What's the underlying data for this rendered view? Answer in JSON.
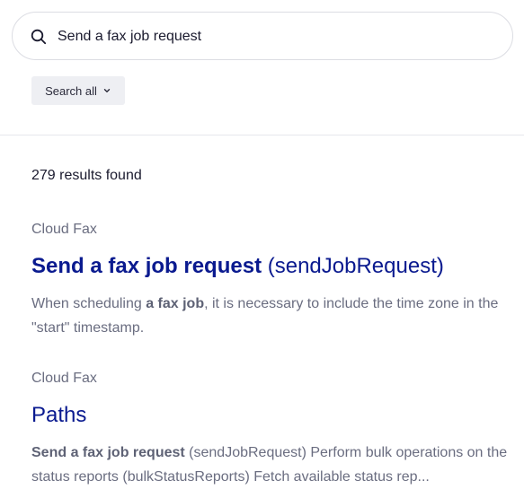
{
  "search": {
    "value": "Send a fax job request",
    "placeholder": "Search"
  },
  "scope": {
    "label": "Search all"
  },
  "results_count": "279 results found",
  "results": [
    {
      "category": "Cloud Fax",
      "title_bold": "Send a fax job request",
      "title_rest": " (sendJobRequest)",
      "snippet_pre": "When scheduling ",
      "snippet_bold": "a fax job",
      "snippet_post": ", it is necessary to include the time zone in the \"start\" timestamp."
    },
    {
      "category": "Cloud Fax",
      "title_bold": "",
      "title_rest": "Paths",
      "snippet_pre": "",
      "snippet_bold": "Send a fax job request",
      "snippet_post": " (sendJobRequest) Perform bulk operations on the status reports (bulkStatusReports) Fetch available status rep..."
    }
  ],
  "icons": {
    "search": "search-icon",
    "scope_chevron": "chevron-down-icon"
  }
}
